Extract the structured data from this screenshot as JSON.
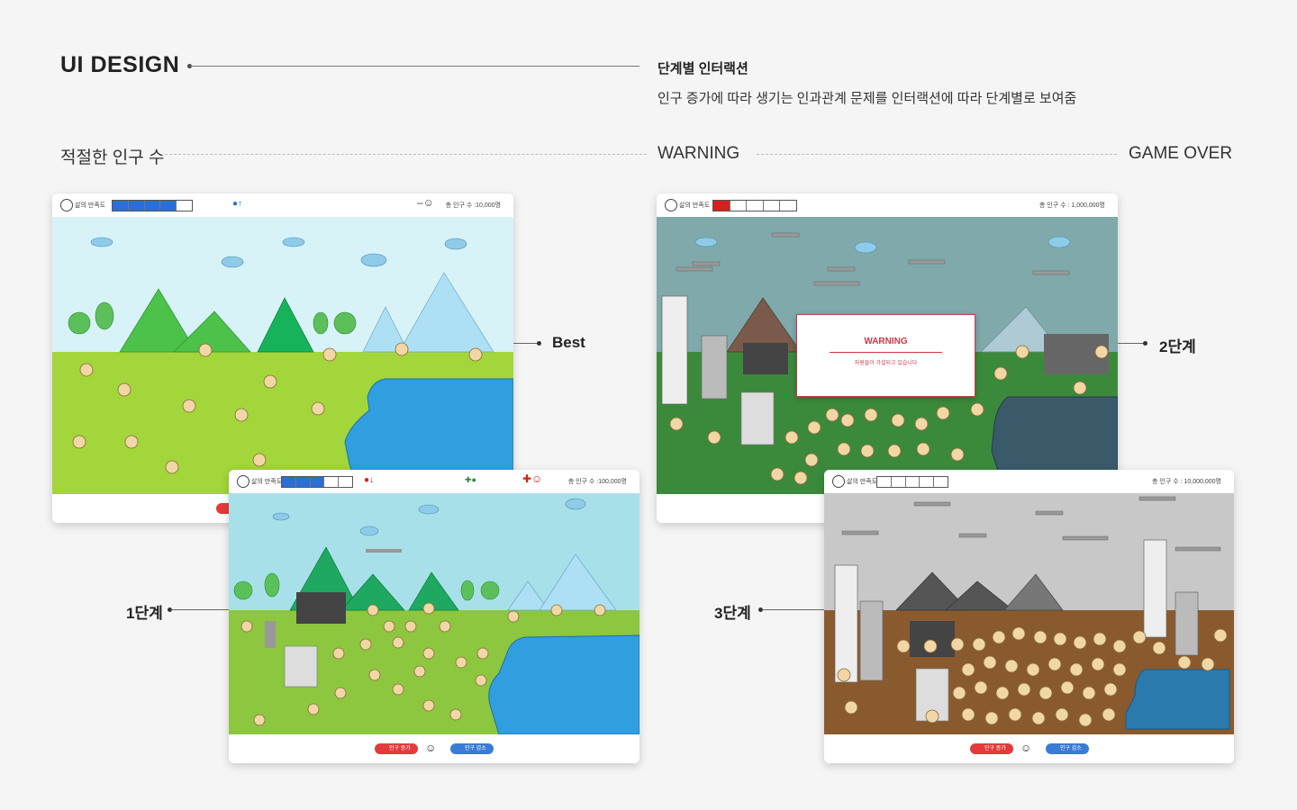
{
  "header": {
    "title": "UI DESIGN",
    "subtitle": "단계별 인터랙션",
    "description": "인구 증가에 따라 생기는 인과관계 문제를 인터랙션에 따라 단계별로 보여줌"
  },
  "sections": {
    "left": "적절한 인구 수",
    "middle": "WARNING",
    "right": "GAME OVER"
  },
  "stage_labels": {
    "best": "Best",
    "stage1": "1단계",
    "stage2": "2단계",
    "stage3": "3단계"
  },
  "hud": {
    "satisfaction_label": "삶의 만족도",
    "best_population": "총 인구 수 :10,000명",
    "stage1_population": "총 인구 수 :100,000명",
    "stage2_population": "총 인구 수 : 1,000,000명",
    "stage3_population": "총 인구 수 : 10,000,000명",
    "increase_button": "인구 증가",
    "decrease_button": "인구 감소"
  },
  "meters": {
    "best": {
      "filled": 4,
      "total": 5,
      "color": "#2a6fd6"
    },
    "stage1": {
      "filled": 3,
      "total": 5,
      "color": "#2a6fd6"
    },
    "stage2": {
      "filled": 1,
      "total": 5,
      "color": "#d42020"
    },
    "stage3": {
      "filled": 0,
      "total": 5,
      "color": "#d42020"
    }
  },
  "warning_popup": {
    "title": "WARNING",
    "message": "자원들이 가설되고 있습니다"
  },
  "colors": {
    "sky_best": "#d8f3f8",
    "grass_best": "#a3d63a",
    "water": "#2f9fe0",
    "sky_warning": "#7fa9ab",
    "grass_warning": "#3b8a3c",
    "sky_gameover": "#c8c8c8",
    "ground_gameover": "#8a5a2f"
  }
}
